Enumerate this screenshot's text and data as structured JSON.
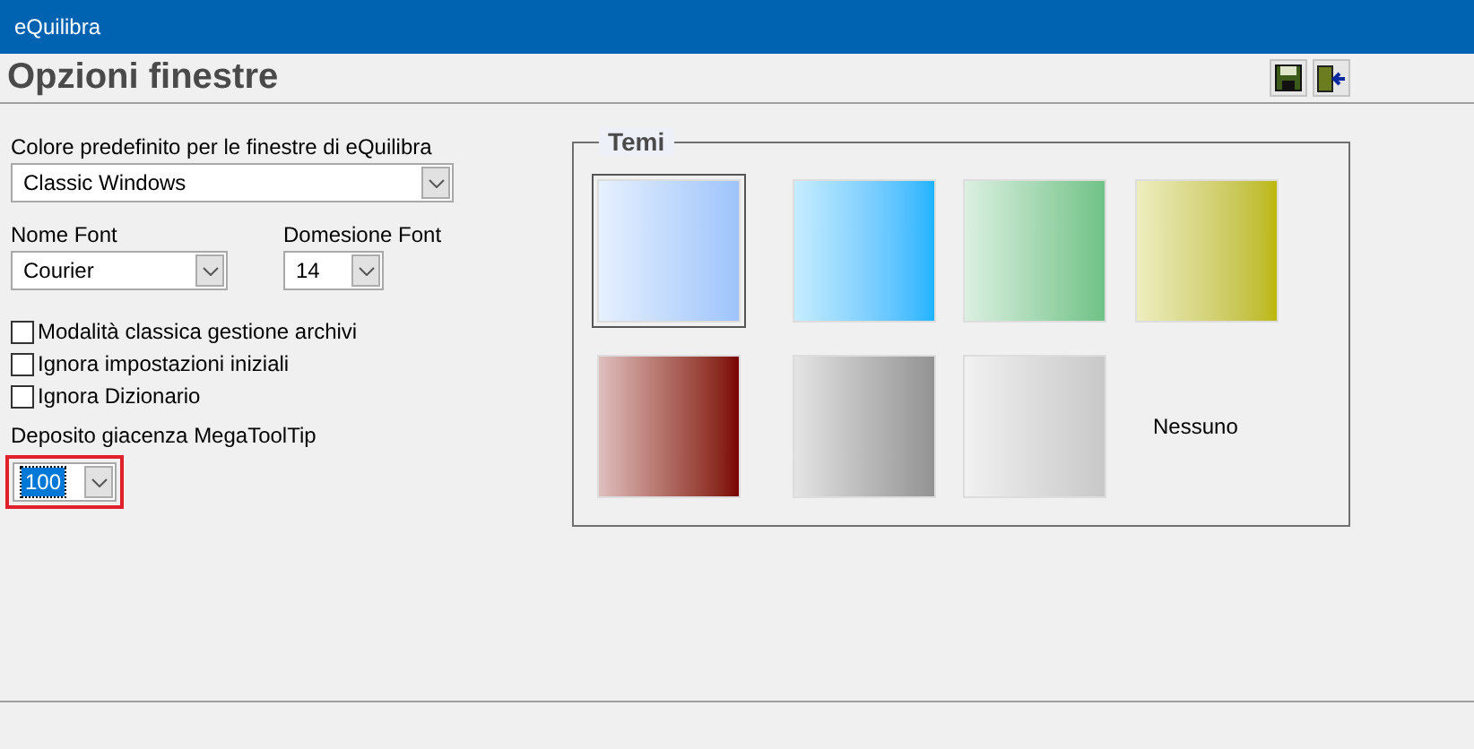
{
  "window": {
    "title": "eQuilibra"
  },
  "header": {
    "title": "Opzioni finestre",
    "tools": [
      {
        "kind": "save"
      },
      {
        "kind": "exit"
      }
    ]
  },
  "default_color": {
    "label": "Colore predefinito per le finestre di eQuilibra",
    "value": "Classic Windows"
  },
  "font_name": {
    "label": "Nome Font",
    "value": "Courier"
  },
  "font_size": {
    "label": "Domesione Font",
    "value": "14"
  },
  "checkboxes": [
    {
      "label": "Modalità classica gestione archivi",
      "checked": false
    },
    {
      "label": "Ignora impostazioni iniziali",
      "checked": false
    },
    {
      "label": "Ignora Dizionario",
      "checked": false
    }
  ],
  "tooltip_store": {
    "label": "Deposito giacenza MegaToolTip",
    "value": "100",
    "focused": true
  },
  "themes": {
    "title": "Temi",
    "items": [
      {
        "kind": "swatch",
        "color": "#9ec4fb",
        "selected": true
      },
      {
        "kind": "swatch",
        "color": "#1ab4ff",
        "selected": false
      },
      {
        "kind": "swatch",
        "color": "#6fc287",
        "selected": false
      },
      {
        "kind": "swatch",
        "color": "#bcb800",
        "selected": false
      },
      {
        "kind": "swatch",
        "color": "#7a0000",
        "selected": false
      },
      {
        "kind": "swatch",
        "color": "#939393",
        "selected": false
      },
      {
        "kind": "swatch",
        "color": "#c8c8c8",
        "selected": false
      },
      {
        "kind": "none",
        "label": "Nessuno",
        "selected": false
      }
    ]
  }
}
